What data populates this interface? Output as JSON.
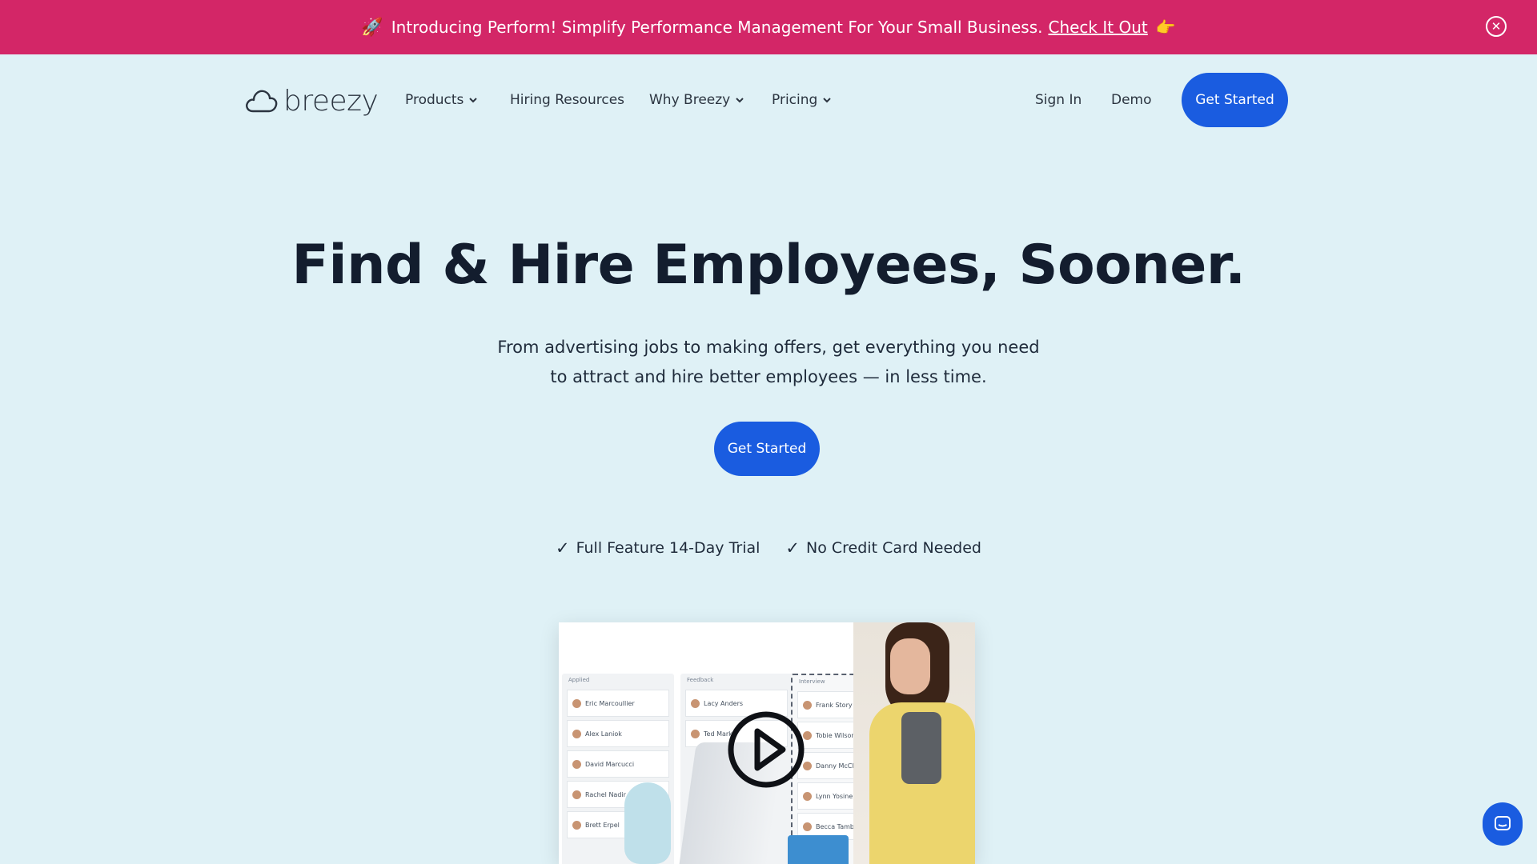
{
  "announcement": {
    "rocket_icon": "rocket-icon",
    "text": "Introducing Perform! Simplify Performance Management For Your Small Business.",
    "link": "Check It Out",
    "hand_icon": "pointing-hand-icon",
    "close_icon": "close-icon",
    "background": "#d32667"
  },
  "nav": {
    "logo_text": "breezy",
    "items": [
      {
        "label": "Products",
        "has_dropdown": true
      },
      {
        "label": "Hiring Resources",
        "has_dropdown": false
      },
      {
        "label": "Why Breezy",
        "has_dropdown": true
      },
      {
        "label": "Pricing",
        "has_dropdown": true
      }
    ],
    "sign_in": "Sign In",
    "demo": "Demo",
    "cta": "Get Started"
  },
  "hero": {
    "title": "Find & Hire Employees, Sooner.",
    "subtitle_line1": "From advertising jobs to making offers, get everything you need",
    "subtitle_line2": "to attract and hire better employees — in less time.",
    "cta": "Get Started",
    "checks": [
      "Full Feature 14-Day Trial",
      "No Credit Card Needed"
    ]
  },
  "video": {
    "columns": [
      {
        "head": "Applied",
        "cards": [
          "Eric Marcoullier",
          "Alex Laniok",
          "David Marcucci",
          "Rachel Nadir",
          "Brett Erpel"
        ]
      },
      {
        "head": "Feedback",
        "cards": [
          "Lacy Anders",
          "Ted Mark"
        ]
      },
      {
        "head": "Interview",
        "cards": [
          "Frank Story",
          "Tobie Wilson",
          "Danny McCleney",
          "Lynn Yosine",
          "Becca Tamberlin"
        ]
      }
    ],
    "play_icon": "play-icon"
  },
  "colors": {
    "page_bg": "#dff1f6",
    "accent": "#1a5ce0",
    "text": "#131d2e"
  }
}
